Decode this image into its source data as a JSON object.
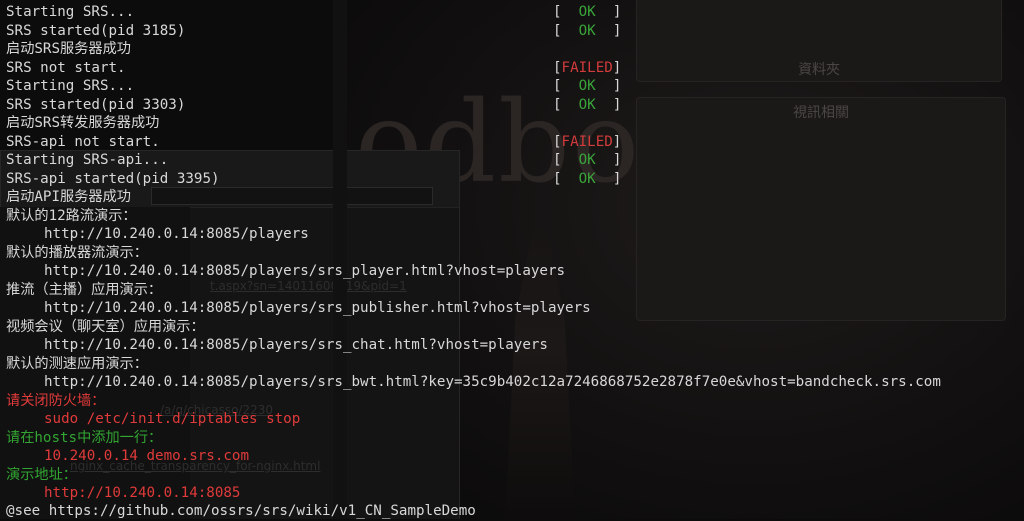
{
  "background": {
    "panel_top_label": "資料夾",
    "panel_mid_label": "視訊相關",
    "logo_text": "odborne",
    "link_1": "t.aspx?sn=14011600019&pid=1",
    "link_2": "/a/g/chicasso/2230",
    "link_3": "nginx_cache_transparency_for-nginx.html"
  },
  "terminal": {
    "status_open": "[",
    "status_close": "]",
    "lines": [
      {
        "text": "Starting SRS...",
        "status": "OK"
      },
      {
        "text": "SRS started(pid 3185)",
        "status": "OK"
      },
      {
        "text": "启动SRS服务器成功"
      },
      {
        "text": "SRS not start.",
        "status": "FAILED"
      },
      {
        "text": "Starting SRS...",
        "status": "OK"
      },
      {
        "text": "SRS started(pid 3303)",
        "status": "OK"
      },
      {
        "text": "启动SRS转发服务器成功"
      },
      {
        "text": "SRS-api not start.",
        "status": "FAILED"
      },
      {
        "text": "Starting SRS-api...",
        "status": "OK"
      },
      {
        "text": "SRS-api started(pid 3395)",
        "status": "OK"
      },
      {
        "text": "启动API服务器成功"
      },
      {
        "text": "默认的12路流演示："
      },
      {
        "text": "http://10.240.0.14:8085/players"
      },
      {
        "text": "默认的播放器流演示："
      },
      {
        "text": "http://10.240.0.14:8085/players/srs_player.html?vhost=players"
      },
      {
        "text": "推流（主播）应用演示："
      },
      {
        "text": "http://10.240.0.14:8085/players/srs_publisher.html?vhost=players"
      },
      {
        "text": "视频会议（聊天室）应用演示："
      },
      {
        "text": "http://10.240.0.14:8085/players/srs_chat.html?vhost=players"
      },
      {
        "text": "默认的测速应用演示："
      },
      {
        "text": "http://10.240.0.14:8085/players/srs_bwt.html?key=35c9b402c12a7246868752e2878f7e0e&vhost=bandcheck.srs.com"
      },
      {
        "text": "请关闭防火墙："
      },
      {
        "text": "sudo /etc/init.d/iptables stop"
      },
      {
        "text": "请在hosts中添加一行："
      },
      {
        "text": "10.240.0.14 demo.srs.com"
      },
      {
        "text": "演示地址："
      },
      {
        "text": "http://10.240.0.14:8085"
      },
      {
        "text": "@see https://github.com/ossrs/srs/wiki/v1_CN_SampleDemo"
      }
    ]
  },
  "colors": {
    "ok": "#3aa43a",
    "failed": "#d23b3b",
    "warning_red": "#e03a3a",
    "hint_green": "#32a532",
    "text": "#d8d8d8"
  }
}
